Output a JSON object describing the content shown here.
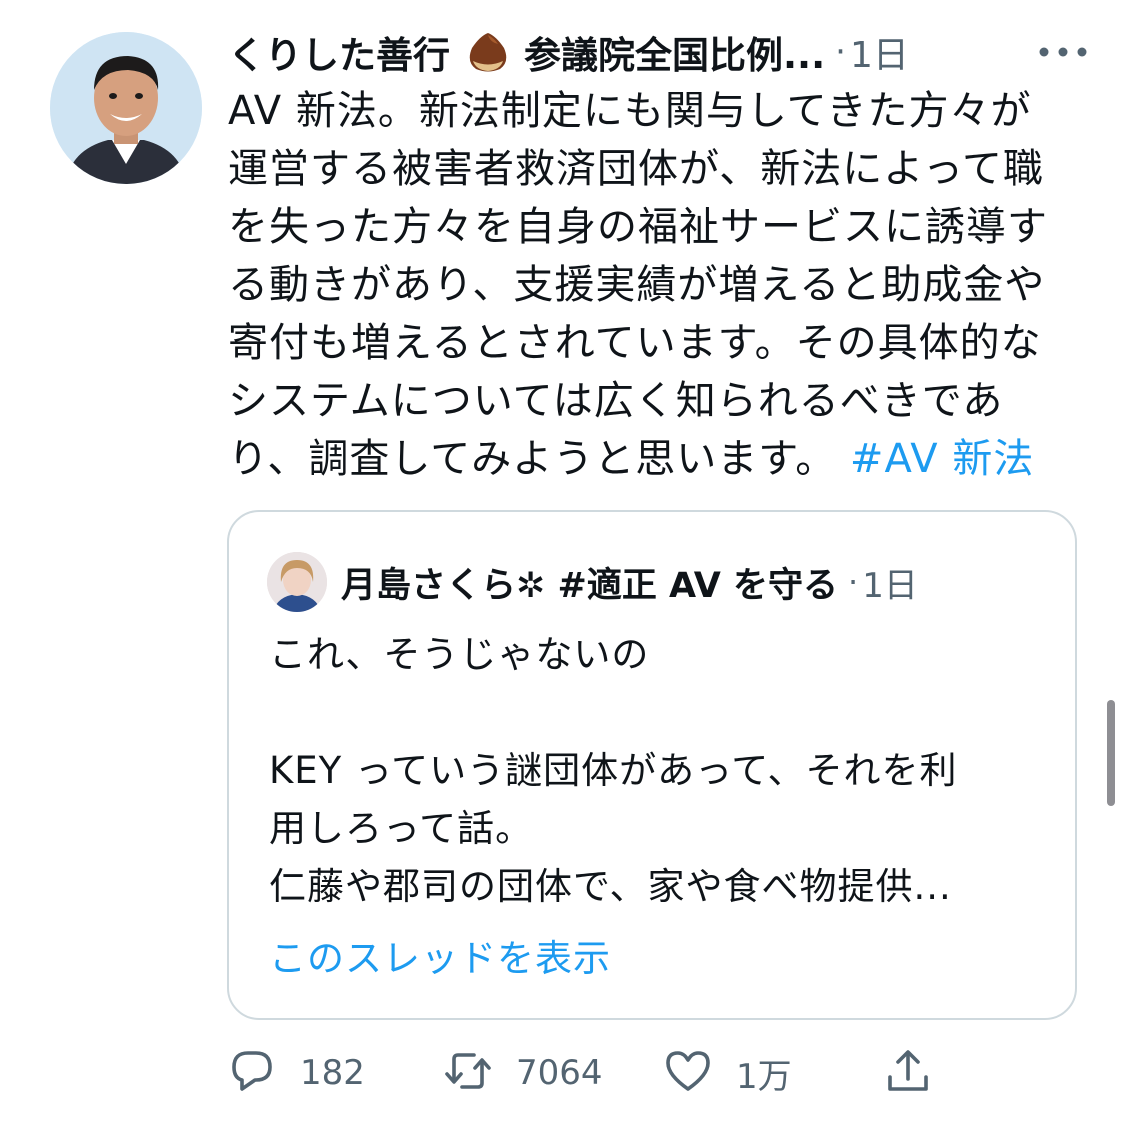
{
  "tweet": {
    "author_name": "くりした善行",
    "author_emoji": "chestnut-icon",
    "author_affiliation": "参議院全国比例...",
    "separator": "·",
    "time": "1日",
    "text_lines": [
      "AV 新法。新法制定にも関与してきた方々が",
      "運営する被害者救済団体が、新法によって職",
      "を失った方々を自身の福祉サービスに誘導す",
      "る動きがあり、支援実績が増えると助成金や",
      "寄付も増えるとされています。その具体的な",
      "システムについては広く知られるべきであ"
    ],
    "last_line_text": "り、調査してみようと思います。",
    "hashtag": "#AV 新法"
  },
  "quote": {
    "author_name": "月島さくら✲ #適正 AV を守る",
    "separator": "·",
    "time": "1日",
    "text_lines": [
      "これ、そうじゃないの",
      "",
      "KEY っていう謎団体があって、それを利",
      "用しろって話。",
      "仁藤や郡司の団体で、家や食べ物提供..."
    ],
    "show_thread": "このスレッドを表示"
  },
  "actions": {
    "reply_count": "182",
    "retweet_count": "7064",
    "like_count": "1万"
  },
  "colors": {
    "accent": "#1d9bf0",
    "secondary_text": "#536471",
    "border": "#cfd9de"
  }
}
